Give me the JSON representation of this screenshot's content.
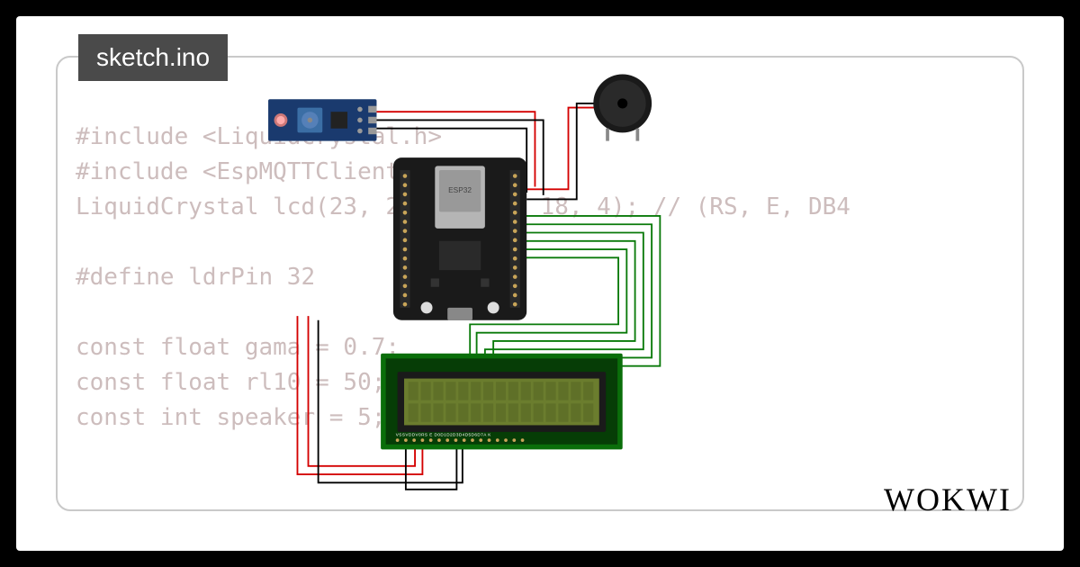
{
  "filename": "sketch.ino",
  "logo": "WOKWI",
  "code": {
    "line1": "#include <LiquidCrystal.h>",
    "line2": "#include <EspMQTTClient.h>",
    "line3": "LiquidCrystal lcd(23, 22, 5, 19, 18, 4); // (RS, E, DB4",
    "line4": "",
    "line5": "#define ldrPin 32",
    "line6": "",
    "line7": "const float gama = 0.7;",
    "line8": "const float rl10 = 50;",
    "line9": "const int speaker = 5;"
  },
  "components": {
    "esp32": "ESP32",
    "lcd_pins": "VSSVDDV0RS E D0D1D2D3D4D5D6D7A K",
    "ldr_module": "LDR Sensor Module",
    "buzzer": "Piezo Buzzer",
    "lcd": "LCD 16x2"
  },
  "wire_colors": {
    "power": "#d40000",
    "ground": "#000000",
    "signal": "#0a7a0a"
  }
}
